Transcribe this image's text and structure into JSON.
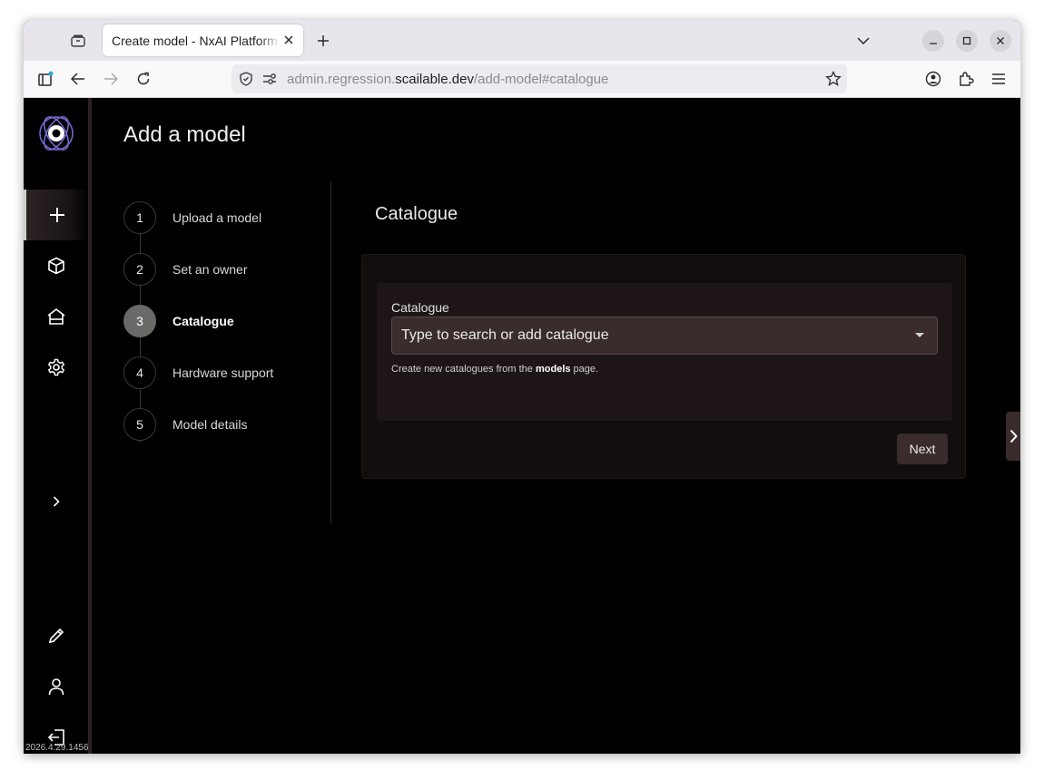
{
  "browser": {
    "tab_title": "Create model - NxAI Platform",
    "url_prefix": "admin.regression.",
    "url_domain": "scailable.dev",
    "url_path": "/add-model#catalogue"
  },
  "app": {
    "version": "2026.4.29.1456",
    "page_title": "Add a model",
    "steps": [
      {
        "number": "1",
        "label": "Upload a model"
      },
      {
        "number": "2",
        "label": "Set an owner"
      },
      {
        "number": "3",
        "label": "Catalogue"
      },
      {
        "number": "4",
        "label": "Hardware support"
      },
      {
        "number": "5",
        "label": "Model details"
      }
    ],
    "active_step": 3,
    "section_title": "Catalogue",
    "form": {
      "field_label": "Catalogue",
      "select_placeholder": "Type to search or add catalogue",
      "helper_before": "Create new catalogues from the ",
      "helper_link": "models",
      "helper_after": " page."
    },
    "next_label": "Next"
  },
  "colors": {
    "accent": "#7b6cd9",
    "background": "#000000",
    "button_bg": "#3a2c2c"
  }
}
